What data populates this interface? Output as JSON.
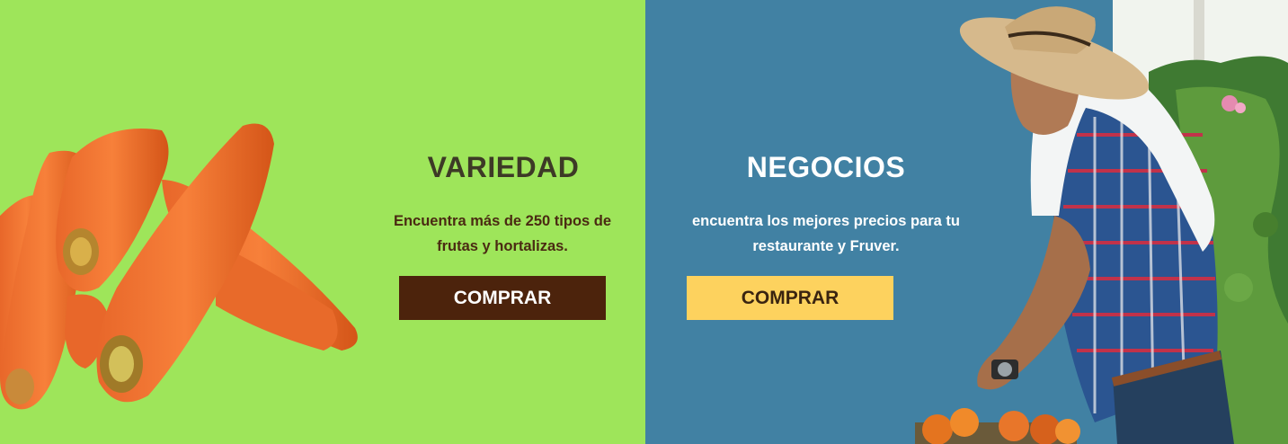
{
  "variedad": {
    "title": "VARIEDAD",
    "description": "Encuentra más de 250 tipos de frutas y hortalizas.",
    "button_label": "COMPRAR",
    "colors": {
      "background": "#9ee55a",
      "title": "#3d3a26",
      "text": "#4a2a12",
      "button_bg": "#4c230c",
      "button_text": "#ffffff"
    }
  },
  "negocios": {
    "title": "NEGOCIOS",
    "description": "encuentra los mejores precios para tu restaurante y Fruver.",
    "button_label": "COMPRAR",
    "colors": {
      "background": "#4181a3",
      "title": "#ffffff",
      "text": "#ffffff",
      "button_bg": "#fdd25e",
      "button_text": "#3a2410"
    }
  }
}
